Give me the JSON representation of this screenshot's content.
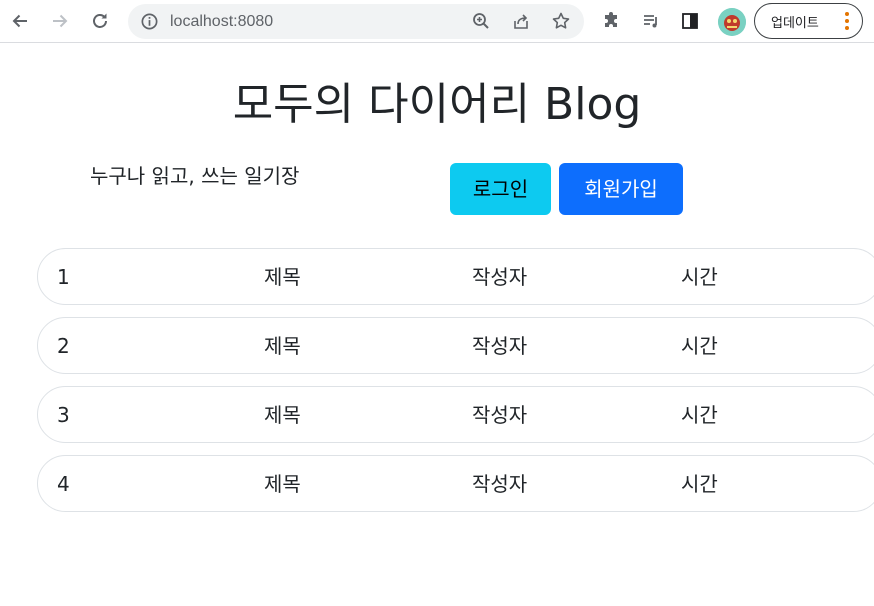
{
  "browser": {
    "url": "localhost:8080",
    "update_label": "업데이트",
    "icons": [
      "back-icon",
      "forward-icon",
      "reload-icon",
      "info-icon",
      "zoom-icon",
      "share-icon",
      "star-icon",
      "extensions-icon",
      "reading-list-icon",
      "side-panel-icon",
      "profile-avatar",
      "more-icon"
    ]
  },
  "header": {
    "title": "모두의 다이어리 Blog",
    "tagline": "누구나 읽고, 쓰는 일기장",
    "login_label": "로그인",
    "signup_label": "회원가입"
  },
  "posts": [
    {
      "num": "1",
      "title": "제목",
      "author": "작성자",
      "time": "시간"
    },
    {
      "num": "2",
      "title": "제목",
      "author": "작성자",
      "time": "시간"
    },
    {
      "num": "3",
      "title": "제목",
      "author": "작성자",
      "time": "시간"
    },
    {
      "num": "4",
      "title": "제목",
      "author": "작성자",
      "time": "시간"
    }
  ],
  "colors": {
    "login_button": "#0dcaf0",
    "signup_button": "#0d6efd",
    "row_border": "#dee2e6"
  }
}
